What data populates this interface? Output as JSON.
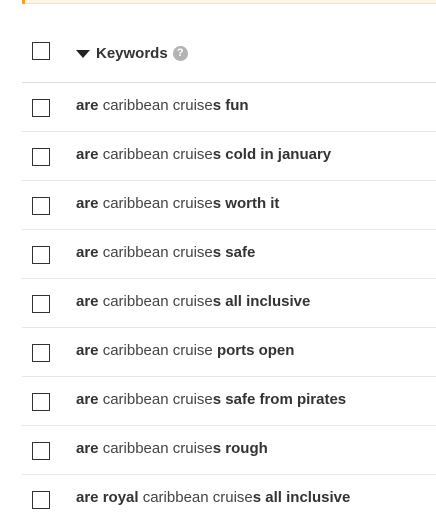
{
  "header": {
    "column_label": "Keywords",
    "help_glyph": "?"
  },
  "rows": [
    {
      "segments": [
        {
          "text": "are",
          "bold": true
        },
        {
          "text": " caribbean cruise",
          "bold": false
        },
        {
          "text": "s fun",
          "bold": true
        }
      ]
    },
    {
      "segments": [
        {
          "text": "are",
          "bold": true
        },
        {
          "text": " caribbean cruise",
          "bold": false
        },
        {
          "text": "s cold in january",
          "bold": true
        }
      ]
    },
    {
      "segments": [
        {
          "text": "are",
          "bold": true
        },
        {
          "text": " caribbean cruise",
          "bold": false
        },
        {
          "text": "s worth it",
          "bold": true
        }
      ]
    },
    {
      "segments": [
        {
          "text": "are",
          "bold": true
        },
        {
          "text": " caribbean cruise",
          "bold": false
        },
        {
          "text": "s safe",
          "bold": true
        }
      ]
    },
    {
      "segments": [
        {
          "text": "are",
          "bold": true
        },
        {
          "text": " caribbean cruise",
          "bold": false
        },
        {
          "text": "s all inclusive",
          "bold": true
        }
      ]
    },
    {
      "segments": [
        {
          "text": "are",
          "bold": true
        },
        {
          "text": " caribbean cruise ",
          "bold": false
        },
        {
          "text": "ports open",
          "bold": true
        }
      ]
    },
    {
      "segments": [
        {
          "text": "are",
          "bold": true
        },
        {
          "text": " caribbean cruise",
          "bold": false
        },
        {
          "text": "s safe from pirates",
          "bold": true
        }
      ]
    },
    {
      "segments": [
        {
          "text": "are",
          "bold": true
        },
        {
          "text": " caribbean cruise",
          "bold": false
        },
        {
          "text": "s rough",
          "bold": true
        }
      ]
    },
    {
      "segments": [
        {
          "text": "are royal",
          "bold": true
        },
        {
          "text": " caribbean cruise",
          "bold": false
        },
        {
          "text": "s all inclusive",
          "bold": true
        }
      ]
    }
  ]
}
